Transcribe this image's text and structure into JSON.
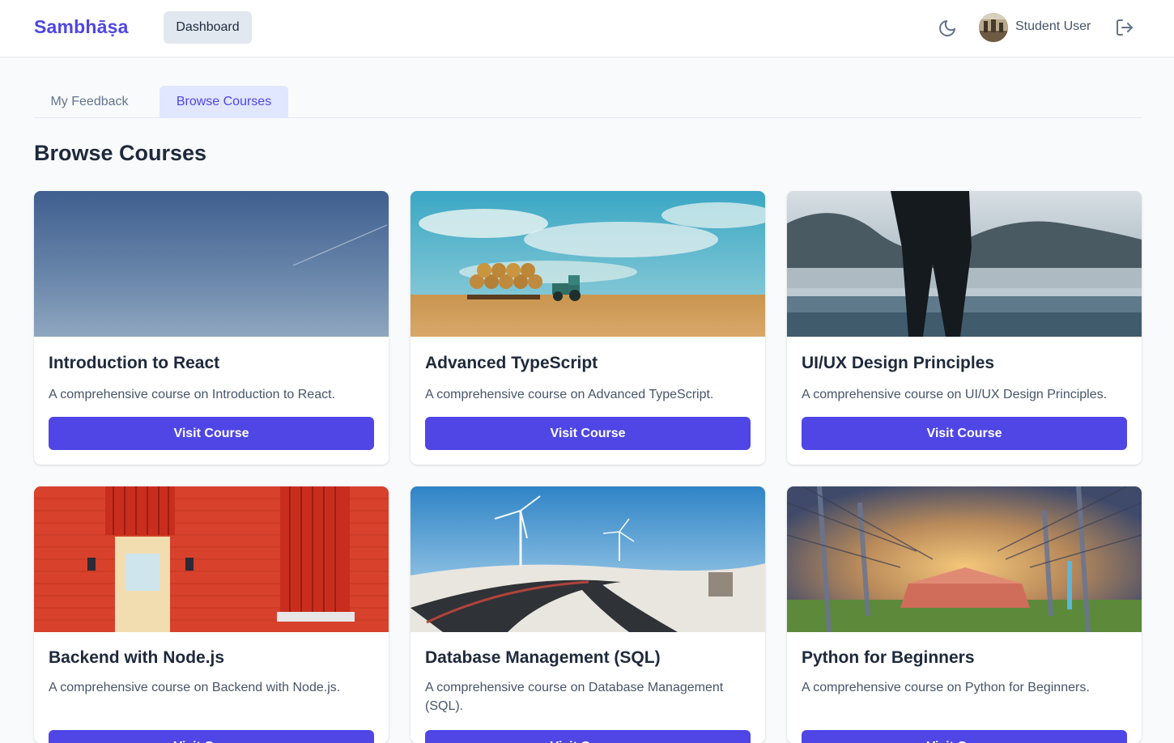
{
  "header": {
    "logo": "Sambhāṣa",
    "nav_dashboard": "Dashboard",
    "theme_icon": "moon-icon",
    "user_name": "Student User",
    "logout_icon": "logout-icon"
  },
  "tabs": [
    {
      "label": "My Feedback",
      "active": false
    },
    {
      "label": "Browse Courses",
      "active": true
    }
  ],
  "page": {
    "title": "Browse Courses"
  },
  "courses": [
    {
      "title": "Introduction to React",
      "description": "A comprehensive course on Introduction to React.",
      "button": "Visit Course",
      "image": "sky-with-contrail"
    },
    {
      "title": "Advanced TypeScript",
      "description": "A comprehensive course on Advanced TypeScript.",
      "button": "Visit Course",
      "image": "tractor-hay-field"
    },
    {
      "title": "UI/UX Design Principles",
      "description": "A comprehensive course on UI/UX Design Principles.",
      "button": "Visit Course",
      "image": "person-by-misty-lake"
    },
    {
      "title": "Backend with Node.js",
      "description": "A comprehensive course on Backend with Node.js.",
      "button": "Visit Course",
      "image": "red-brick-wall-door"
    },
    {
      "title": "Database Management (SQL)",
      "description": "A comprehensive course on Database Management (SQL).",
      "button": "Visit Course",
      "image": "wind-turbines-road"
    },
    {
      "title": "Python for Beginners",
      "description": "A comprehensive course on Python for Beginners.",
      "button": "Visit Course",
      "image": "tree-lined-path-barn"
    }
  ],
  "colors": {
    "accent": "#4f46e5",
    "accent_light": "#e0e7ff",
    "background": "#f8fafc"
  }
}
